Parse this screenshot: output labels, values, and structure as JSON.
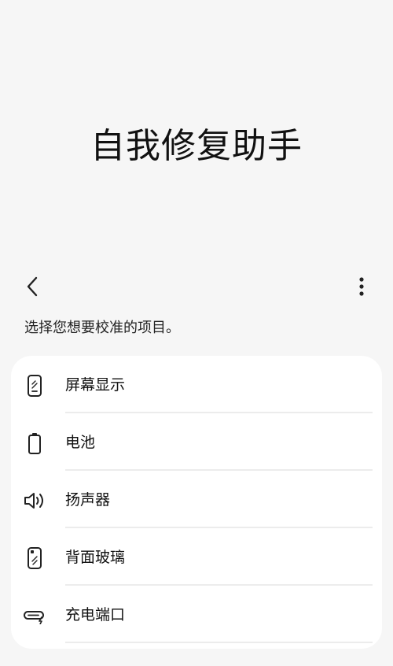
{
  "header": {
    "title": "自我修复助手"
  },
  "toolbar": {
    "back_icon": "chevron-left-icon",
    "more_icon": "more-vertical-icon"
  },
  "prompt": {
    "text": "选择您想要校准的项目。"
  },
  "items": [
    {
      "label": "屏幕显示",
      "icon": "phone-screen-icon"
    },
    {
      "label": "电池",
      "icon": "battery-icon"
    },
    {
      "label": "扬声器",
      "icon": "speaker-icon"
    },
    {
      "label": "背面玻璃",
      "icon": "phone-back-glass-icon"
    },
    {
      "label": "充电端口",
      "icon": "charging-port-icon"
    }
  ]
}
